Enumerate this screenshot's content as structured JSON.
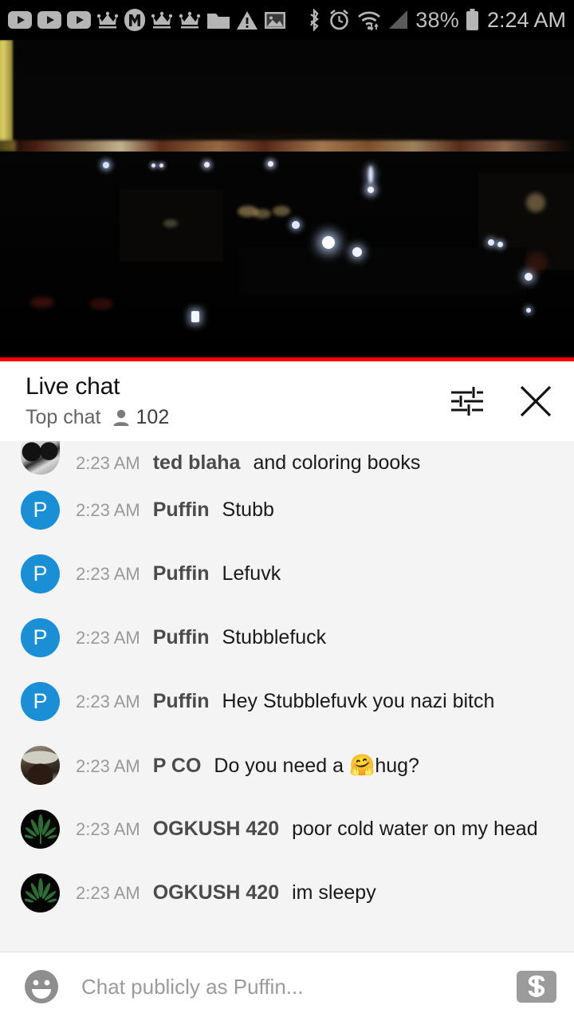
{
  "status_bar": {
    "icons": [
      {
        "name": "youtube-icon",
        "glyph": "▶"
      },
      {
        "name": "youtube-icon",
        "glyph": "▶"
      },
      {
        "name": "youtube-icon",
        "glyph": "▶"
      },
      {
        "name": "crown-icon",
        "glyph": "♔"
      },
      {
        "name": "monogram-m-icon",
        "glyph": "M"
      },
      {
        "name": "crown-icon",
        "glyph": "♔"
      },
      {
        "name": "crown-icon",
        "glyph": "♔"
      },
      {
        "name": "folder-icon",
        "glyph": "▰"
      },
      {
        "name": "warning-icon",
        "glyph": "⚠"
      },
      {
        "name": "image-icon",
        "glyph": "▣"
      }
    ],
    "bluetooth": "bluetooth-icon",
    "alarm": "alarm-icon",
    "wifi": "wifi-icon",
    "signal": "cell-signal-icon",
    "battery_percent": "38%",
    "battery": "battery-icon",
    "clock": "2:24 AM"
  },
  "video": {
    "name": "live-stream-player",
    "progress_color": "#ff0000",
    "progress_percent": 100
  },
  "chat_header": {
    "title": "Live chat",
    "subtitle": "Top chat",
    "viewer_icon": "person-icon",
    "viewer_count": "102",
    "settings_icon": "tune-icon",
    "close_icon": "close-icon"
  },
  "messages": [
    {
      "timestamp": "2:23 AM",
      "author": "ted blaha",
      "body": "and coloring books",
      "avatar_type": "photo-bw",
      "avatar_letter": "",
      "clipped": true
    },
    {
      "timestamp": "2:23 AM",
      "author": "Puffin",
      "body": "Stubb",
      "avatar_type": "letter-blue",
      "avatar_letter": "P",
      "clipped": false
    },
    {
      "timestamp": "2:23 AM",
      "author": "Puffin",
      "body": "Lefuvk",
      "avatar_type": "letter-blue",
      "avatar_letter": "P",
      "clipped": false
    },
    {
      "timestamp": "2:23 AM",
      "author": "Puffin",
      "body": "Stubblefuck",
      "avatar_type": "letter-blue",
      "avatar_letter": "P",
      "clipped": false
    },
    {
      "timestamp": "2:23 AM",
      "author": "Puffin",
      "body": "Hey Stubblefuvk you nazi bitch",
      "avatar_type": "letter-blue",
      "avatar_letter": "P",
      "clipped": false
    },
    {
      "timestamp": "2:23 AM",
      "author": "P CO",
      "body_before_emoji": "Do you need a ",
      "emoji": "🤗",
      "body_after_emoji": "hug?",
      "body": "Do you need a 🤗hug?",
      "avatar_type": "photo-hat",
      "avatar_letter": "",
      "clipped": false
    },
    {
      "timestamp": "2:23 AM",
      "author": "OGKUSH 420",
      "body": "poor cold water on my head",
      "avatar_type": "photo-leaf",
      "avatar_letter": "",
      "clipped": false
    },
    {
      "timestamp": "2:23 AM",
      "author": "OGKUSH 420",
      "body": "im sleepy",
      "avatar_type": "photo-leaf",
      "avatar_letter": "",
      "clipped": false
    }
  ],
  "composer": {
    "emoji_icon": "emoji-smiley-icon",
    "placeholder": "Chat publicly as Puffin...",
    "value": "",
    "superchat_icon": "dollar-icon"
  },
  "colors": {
    "avatar_blue": "#1b8fd6",
    "youtube_red": "#ff0000",
    "chat_bg": "#f4f4f4",
    "header_bg": "#ffffff",
    "timestamp_gray": "#9a9a9a",
    "author_gray": "#4b4b4b"
  }
}
